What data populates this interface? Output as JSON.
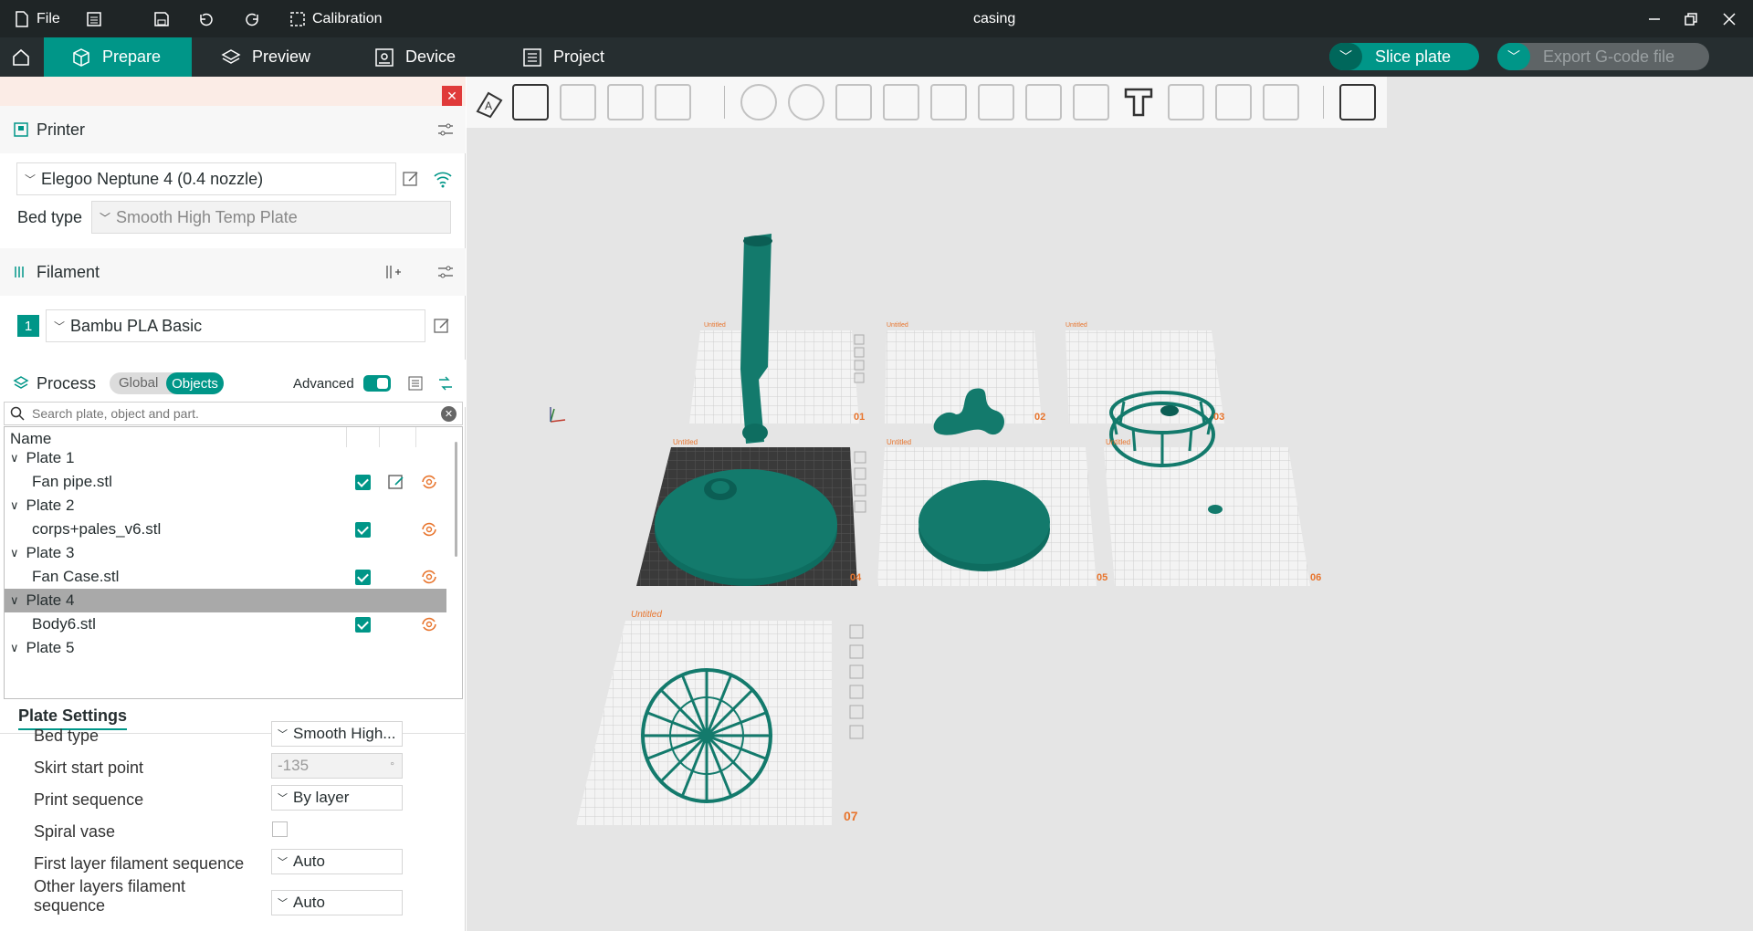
{
  "titlebar": {
    "file": "File",
    "calibration": "Calibration",
    "title": "casing"
  },
  "tabs": {
    "prepare": "Prepare",
    "preview": "Preview",
    "device": "Device",
    "project": "Project"
  },
  "actions": {
    "slice": "Slice plate",
    "export": "Export G-code file"
  },
  "printer": {
    "section": "Printer",
    "name": "Elegoo Neptune 4 (0.4 nozzle)",
    "bed_label": "Bed type",
    "bed_value": "Smooth High Temp Plate"
  },
  "filament": {
    "section": "Filament",
    "index": "1",
    "name": "Bambu PLA Basic"
  },
  "process": {
    "section": "Process",
    "global": "Global",
    "objects": "Objects",
    "advanced": "Advanced"
  },
  "search": {
    "placeholder": "Search plate, object and part."
  },
  "tree": {
    "header": "Name",
    "rows": [
      {
        "label": "Plate 1",
        "type": "plate"
      },
      {
        "label": "Fan pipe.stl",
        "type": "object"
      },
      {
        "label": "Plate 2",
        "type": "plate"
      },
      {
        "label": "corps+pales_v6.stl",
        "type": "object"
      },
      {
        "label": "Plate 3",
        "type": "plate"
      },
      {
        "label": "Fan Case.stl",
        "type": "object"
      },
      {
        "label": "Plate 4",
        "type": "plate",
        "selected": true
      },
      {
        "label": "Body6.stl",
        "type": "object"
      },
      {
        "label": "Plate 5",
        "type": "plate"
      }
    ]
  },
  "plate_settings": {
    "tab": "Plate Settings",
    "rows": [
      {
        "label": "Bed type",
        "value": "Smooth High..."
      },
      {
        "label": "Skirt start point",
        "value": "-135",
        "unit": "°"
      },
      {
        "label": "Print sequence",
        "value": "By layer"
      },
      {
        "label": "Spiral vase",
        "value": ""
      },
      {
        "label": "First layer filament sequence",
        "value": "Auto"
      },
      {
        "label": "Other layers filament sequence",
        "value": "Auto"
      }
    ]
  },
  "plates": [
    {
      "num": "01",
      "name": "Untitled"
    },
    {
      "num": "02",
      "name": "Untitled"
    },
    {
      "num": "03",
      "name": "Untitled"
    },
    {
      "num": "04",
      "name": "Untitled"
    },
    {
      "num": "05",
      "name": "Untitled"
    },
    {
      "num": "06",
      "name": "Untitled"
    },
    {
      "num": "07",
      "name": "Untitled"
    }
  ],
  "colors": {
    "accent": "#009688",
    "model": "#137a6c",
    "dark": "#262e30"
  }
}
